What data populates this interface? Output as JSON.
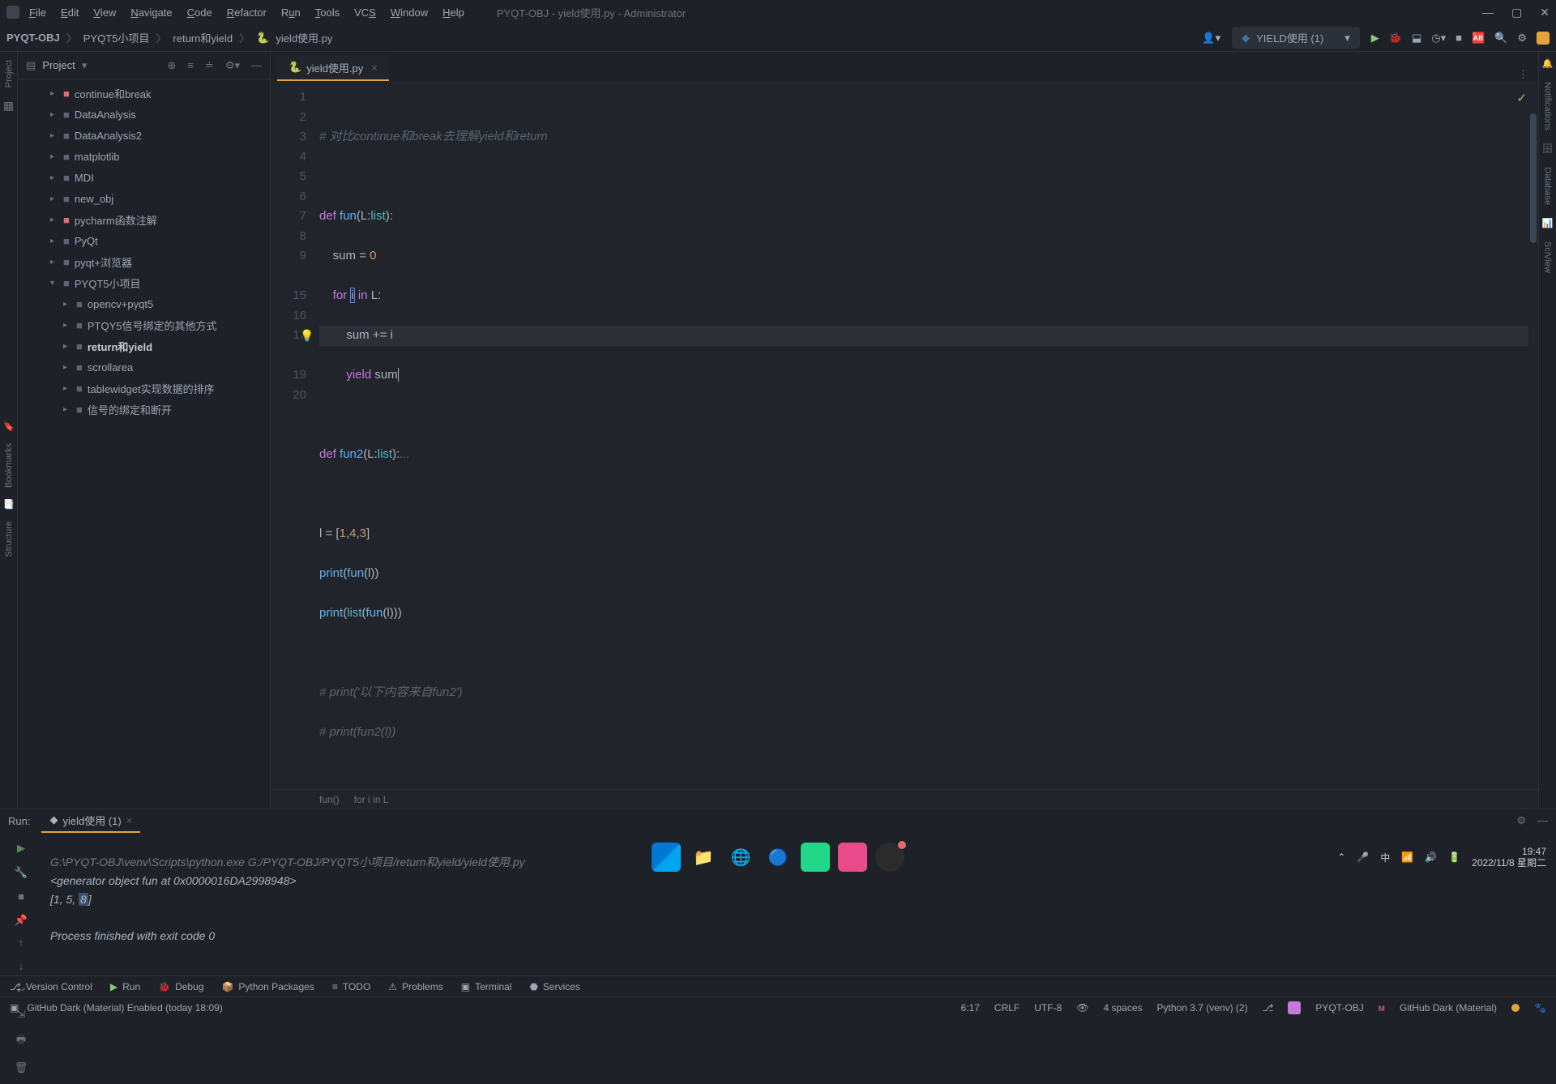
{
  "window": {
    "title": "PYQT-OBJ - yield使用.py - Administrator"
  },
  "menus": [
    "File",
    "Edit",
    "View",
    "Navigate",
    "Code",
    "Refactor",
    "Run",
    "Tools",
    "VCS",
    "Window",
    "Help"
  ],
  "breadcrumbs": {
    "items": [
      "PYQT-OBJ",
      "PYQT5小项目",
      "return和yield",
      "yield使用.py"
    ]
  },
  "run_config": {
    "label": "YIELD使用 (1)"
  },
  "project_panel": {
    "title": "Project"
  },
  "tree": [
    {
      "name": "continue和break",
      "color": "red",
      "depth": 1
    },
    {
      "name": "DataAnalysis",
      "color": "blue",
      "depth": 1
    },
    {
      "name": "DataAnalysis2",
      "color": "blue",
      "depth": 1
    },
    {
      "name": "matplotlib",
      "color": "blue",
      "depth": 1
    },
    {
      "name": "MDI",
      "color": "blue",
      "depth": 1
    },
    {
      "name": "new_obj",
      "color": "blue",
      "depth": 1
    },
    {
      "name": "pycharm函数注解",
      "color": "red",
      "depth": 1
    },
    {
      "name": "PyQt",
      "color": "blue",
      "depth": 1
    },
    {
      "name": "pyqt+浏览器",
      "color": "blue",
      "depth": 1
    },
    {
      "name": "PYQT5小项目",
      "color": "blue",
      "depth": 1,
      "expanded": true
    },
    {
      "name": "opencv+pyqt5",
      "color": "blue",
      "depth": 2
    },
    {
      "name": "PTQY5信号绑定的其他方式",
      "color": "blue",
      "depth": 2
    },
    {
      "name": "return和yield",
      "color": "blue",
      "depth": 2,
      "selected": true
    },
    {
      "name": "scrollarea",
      "color": "blue",
      "depth": 2
    },
    {
      "name": "tablewidget实现数据的排序",
      "color": "blue",
      "depth": 2
    },
    {
      "name": "信号的绑定和断开",
      "color": "blue",
      "depth": 2
    }
  ],
  "editor": {
    "tab": "yield使用.py",
    "lines": [
      1,
      2,
      3,
      4,
      5,
      6,
      7,
      8,
      9,
      "",
      15,
      16,
      17,
      "",
      19,
      20
    ],
    "code_comment1": "# 对比continue和break去理解yield和return",
    "breadcrumb_fn": "fun()",
    "breadcrumb_for": "for i in L"
  },
  "run": {
    "label": "Run:",
    "tab": "yield使用 (1)",
    "line1": "G:\\PYQT-OBJ\\venv\\Scripts\\python.exe G:/PYQT-OBJ/PYQT5小项目/return和yield/yield使用.py",
    "line2": "<generator object fun at 0x0000016DA2998948>",
    "line3_pre": "[1, 5, ",
    "line3_hl": "8",
    "line3_post": "]",
    "line4": "Process finished with exit code 0"
  },
  "bottom_tools": [
    "Version Control",
    "Run",
    "Debug",
    "Python Packages",
    "TODO",
    "Problems",
    "Terminal",
    "Services"
  ],
  "status": {
    "theme": "GitHub Dark (Material) Enabled (today 18:09)",
    "pos": "6:17",
    "eol": "CRLF",
    "enc": "UTF-8",
    "indent": "4 spaces",
    "python": "Python 3.7 (venv) (2)",
    "proj": "PYQT-OBJ",
    "theme2": "GitHub Dark (Material)"
  },
  "taskbar": {
    "time": "19:47",
    "date": "2022/11/8 星期二"
  }
}
